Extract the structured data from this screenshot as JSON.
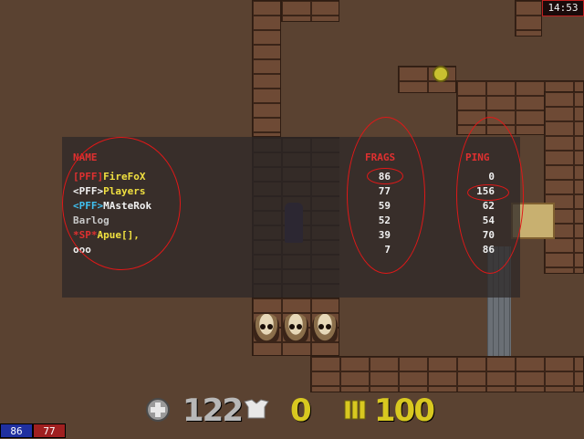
{
  "clock": "14:53",
  "scoreboard": {
    "headers": {
      "name": "NAME",
      "frags": "FRAGS",
      "ping": "PING"
    },
    "players": [
      {
        "prefix": "[PFF]",
        "tag": "FireFoX",
        "frags": "86",
        "ping": "0"
      },
      {
        "prefix": "<PFF>",
        "tag": "Players",
        "frags": "77",
        "ping": "156"
      },
      {
        "prefix": "<PFF>",
        "tag": "MAsteRok",
        "frags": "59",
        "ping": "62"
      },
      {
        "prefix": "",
        "tag": "Barlog",
        "frags": "52",
        "ping": "54"
      },
      {
        "prefix": "*SP*",
        "tag": "Apue[],",
        "frags": "39",
        "ping": "70"
      },
      {
        "prefix": "",
        "tag": "ooo",
        "frags": "7",
        "ping": "86"
      }
    ]
  },
  "hud": {
    "health": "122",
    "armor": "0",
    "ammo": "100",
    "icons": [
      "health-cross-icon",
      "armor-vest-icon",
      "ammo-shells-icon"
    ]
  },
  "team_scores": {
    "blue": "86",
    "red": "77"
  },
  "colors": {
    "accent_red": "#e03030",
    "team_blue": "#2030a0",
    "team_red": "#a02020",
    "hud_yellow": "#d8c820",
    "hud_gray": "#b8b8b8"
  }
}
